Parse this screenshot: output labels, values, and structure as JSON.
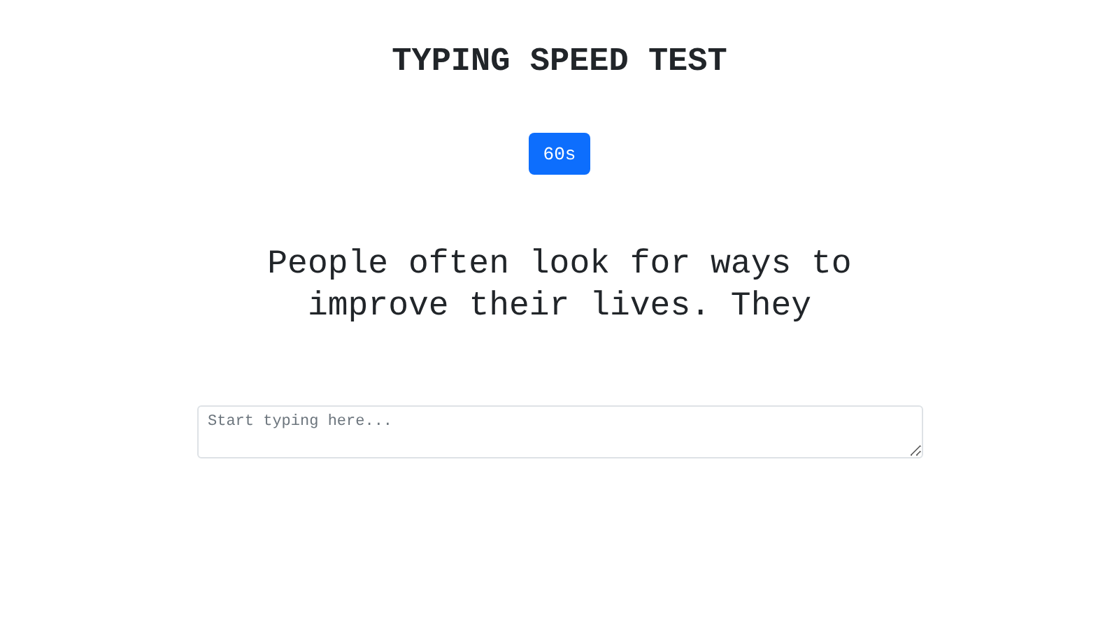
{
  "title": "TYPING SPEED TEST",
  "duration_button": {
    "label": "60s"
  },
  "passage": "People often look for ways to improve their lives. They",
  "input": {
    "placeholder": "Start typing here..."
  }
}
